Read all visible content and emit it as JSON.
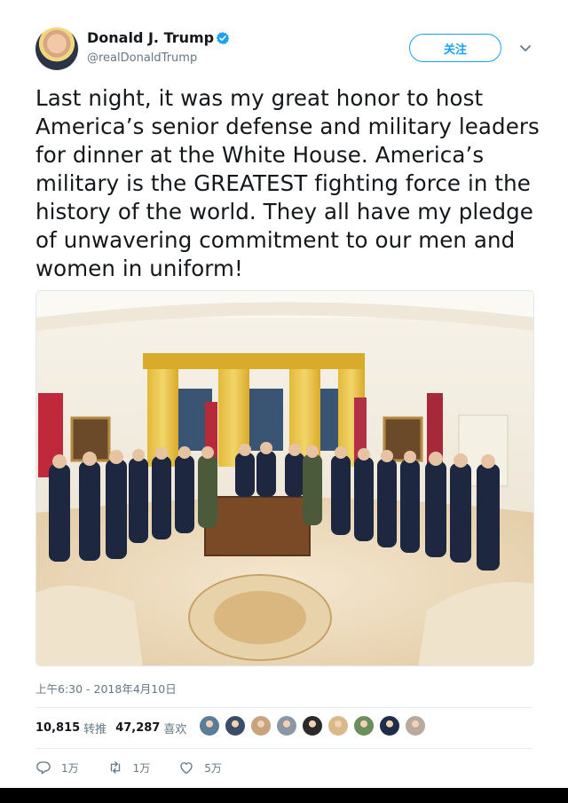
{
  "user": {
    "name": "Donald J. Trump",
    "handle": "@realDonaldTrump",
    "verified": true,
    "follow_label": "关注"
  },
  "tweet": {
    "text": "Last night, it was my great honor to host America’s senior defense and military leaders for dinner at the White House. America’s military is the GREATEST fighting force in the history of the world. They all have my pledge of unwavering commitment to our men and women in uniform!"
  },
  "meta": {
    "timestamp": "上午6:30 - 2018年4月10日",
    "retweets_count": "10,815",
    "retweets_label": "转推",
    "likes_count": "47,287",
    "likes_label": "喜欢"
  },
  "liker_avatar_colors": [
    "#5a7d9a",
    "#3b4c66",
    "#c9a27e",
    "#8c97a6",
    "#2a2a2a",
    "#d9b98a",
    "#6a8f5a",
    "#1f2d4a",
    "#b9aaa0"
  ],
  "actions": {
    "reply_count": "1万",
    "retweet_count": "1万",
    "like_count": "5万"
  },
  "icons": {
    "verified": "verified-badge-icon",
    "caret": "chevron-down-icon",
    "reply": "reply-icon",
    "retweet": "retweet-icon",
    "like": "heart-icon"
  },
  "colors": {
    "accent": "#1da1f2",
    "text": "#14171a",
    "secondary": "#657786"
  }
}
